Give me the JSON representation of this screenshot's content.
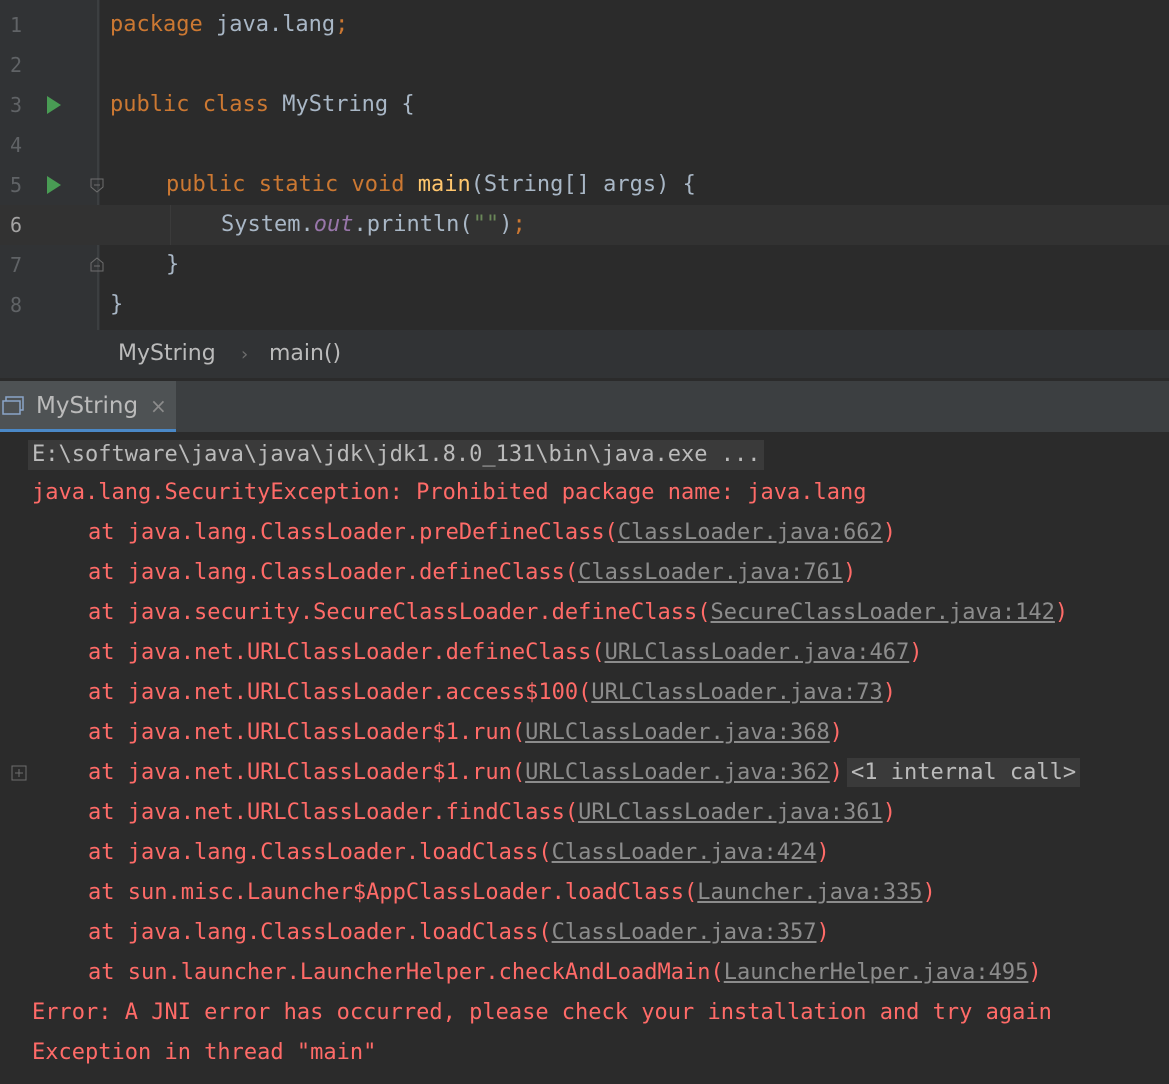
{
  "editor": {
    "line_numbers": [
      "1",
      "2",
      "3",
      "4",
      "5",
      "6",
      "7",
      "8"
    ],
    "line1": {
      "kw": "package",
      "rest": " java.lang",
      "semi": ";"
    },
    "line3": {
      "kw1": "public",
      "kw2": "class",
      "name": " MyString {"
    },
    "line5": {
      "kw1": "public",
      "kw2": "static",
      "kw3": "void",
      "fn": "main",
      "rest": "(String[] args) {"
    },
    "line6": {
      "obj": "System.",
      "field": "out",
      "call": ".println(",
      "str": "\"\"",
      "close": ")",
      "semi": ";"
    },
    "line7": {
      "text": "}"
    },
    "line8": {
      "text": "}"
    }
  },
  "breadcrumb": {
    "items": [
      "MyString",
      "main()"
    ],
    "separator": "›"
  },
  "run_panel": {
    "tab_label": "MyString",
    "close_glyph": "×"
  },
  "console": {
    "command": "E:\\software\\java\\java\\jdk\\jdk1.8.0_131\\bin\\java.exe ...",
    "exception": "java.lang.SecurityException: Prohibited package name: java.lang",
    "frames": [
      {
        "prefix": "at java.lang.ClassLoader.preDefineClass(",
        "link": "ClassLoader.java:662",
        "suffix": ")"
      },
      {
        "prefix": "at java.lang.ClassLoader.defineClass(",
        "link": "ClassLoader.java:761",
        "suffix": ")"
      },
      {
        "prefix": "at java.security.SecureClassLoader.defineClass(",
        "link": "SecureClassLoader.java:142",
        "suffix": ")"
      },
      {
        "prefix": "at java.net.URLClassLoader.defineClass(",
        "link": "URLClassLoader.java:467",
        "suffix": ")"
      },
      {
        "prefix": "at java.net.URLClassLoader.access$100(",
        "link": "URLClassLoader.java:73",
        "suffix": ")"
      },
      {
        "prefix": "at java.net.URLClassLoader$1.run(",
        "link": "URLClassLoader.java:368",
        "suffix": ")"
      },
      {
        "prefix": "at java.net.URLClassLoader$1.run(",
        "link": "URLClassLoader.java:362",
        "suffix": ")",
        "internal": "<1 internal call>"
      },
      {
        "prefix": "at java.net.URLClassLoader.findClass(",
        "link": "URLClassLoader.java:361",
        "suffix": ")"
      },
      {
        "prefix": "at java.lang.ClassLoader.loadClass(",
        "link": "ClassLoader.java:424",
        "suffix": ")"
      },
      {
        "prefix": "at sun.misc.Launcher$AppClassLoader.loadClass(",
        "link": "Launcher.java:335",
        "suffix": ")"
      },
      {
        "prefix": "at java.lang.ClassLoader.loadClass(",
        "link": "ClassLoader.java:357",
        "suffix": ")"
      },
      {
        "prefix": "at sun.launcher.LauncherHelper.checkAndLoadMain(",
        "link": "LauncherHelper.java:495",
        "suffix": ")"
      }
    ],
    "error_line": "Error: A JNI error has occurred, please check your installation and try again",
    "thread_line": "Exception in thread \"main\""
  },
  "colors": {
    "editor_bg": "#2b2b2b",
    "gutter_bg": "#313335",
    "keyword": "#cc7832",
    "method": "#ffc66d",
    "field": "#9876aa",
    "error_text": "#ff6b68",
    "link_text": "#8c8c8c",
    "run_green": "#499c54",
    "accent": "#4a88c7"
  },
  "icons": {
    "run_gutter": "run-triangle-icon",
    "fold": "fold-icon",
    "run_tab": "console-icon",
    "expand": "expand-plus-icon"
  }
}
